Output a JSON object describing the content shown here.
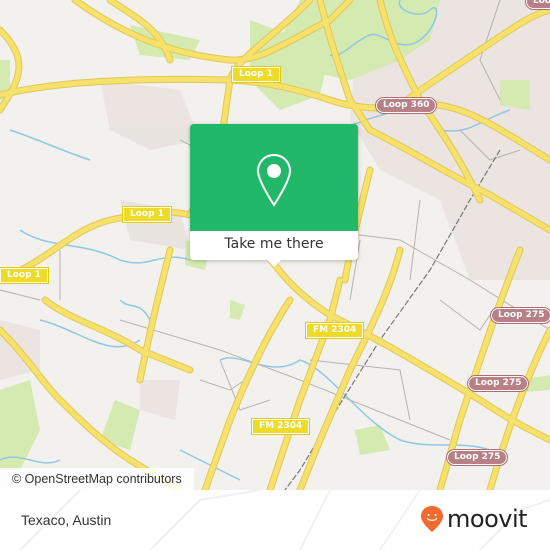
{
  "map": {
    "shields": [
      {
        "id": "loop1-top",
        "text": "Loop 1",
        "style": "yellow"
      },
      {
        "id": "loop360",
        "text": "Loop 360",
        "style": "red"
      },
      {
        "id": "loop1-mid",
        "text": "Loop 1",
        "style": "yellow"
      },
      {
        "id": "loop1-left",
        "text": "Loop 1",
        "style": "yellow"
      },
      {
        "id": "fm2304-a",
        "text": "FM 2304",
        "style": "yellow"
      },
      {
        "id": "fm2304-b",
        "text": "FM 2304",
        "style": "yellow"
      },
      {
        "id": "loop275-a",
        "text": "Loop 275",
        "style": "red"
      },
      {
        "id": "loop275-b",
        "text": "Loop 275",
        "style": "red"
      },
      {
        "id": "loop275-c",
        "text": "Loop 275",
        "style": "red"
      },
      {
        "id": "partial-top-right",
        "text": "Loo",
        "style": "red"
      }
    ],
    "attribution": "© OpenStreetMap contributors",
    "colors": {
      "background": "#f2f1ed",
      "highway": "#f6e16a",
      "park": "#d4eab0",
      "water": "#8fc8e6",
      "urban": "#e8e1dd"
    }
  },
  "popup": {
    "icon": "location-pin-icon",
    "button_label": "Take me there",
    "color": "#21b869"
  },
  "footer": {
    "place_name": "Texaco, Austin",
    "brand": "moovit",
    "brand_color": "#f26a2e"
  }
}
